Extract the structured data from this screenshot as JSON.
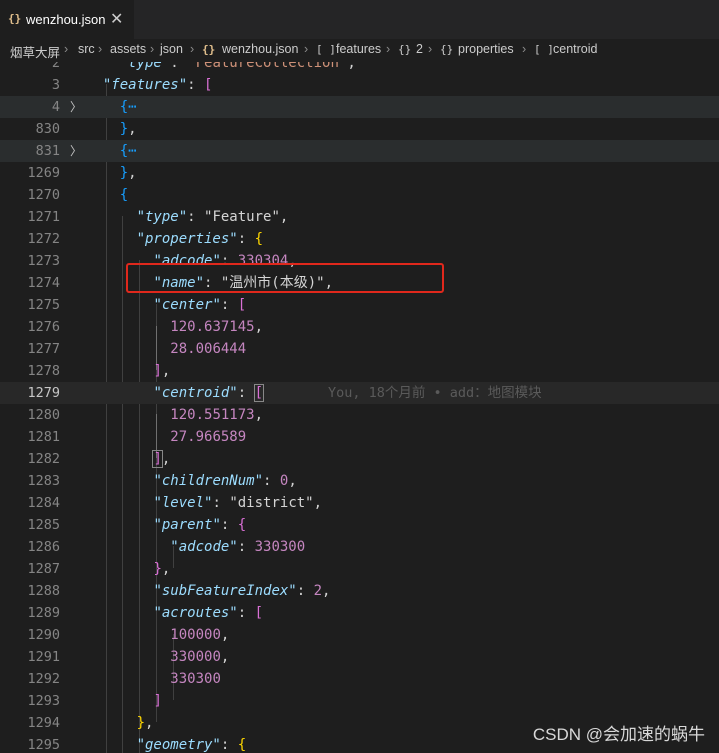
{
  "tab": {
    "icon": "{}",
    "title": "wenzhou.json",
    "close": "✕"
  },
  "breadcrumb": [
    "烟草大屏",
    "src",
    "assets",
    "json",
    "wenzhou.json",
    "features",
    "2",
    "properties",
    "centroid"
  ],
  "lines": {
    "l2": "2",
    "l3": "3",
    "l4": "4",
    "l830": "830",
    "l831": "831",
    "l1269": "1269",
    "l1270": "1270",
    "l1271": "1271",
    "l1272": "1272",
    "l1273": "1273",
    "l1274": "1274",
    "l1275": "1275",
    "l1276": "1276",
    "l1277": "1277",
    "l1278": "1278",
    "l1279": "1279",
    "l1280": "1280",
    "l1281": "1281",
    "l1282": "1282",
    "l1283": "1283",
    "l1284": "1284",
    "l1285": "1285",
    "l1286": "1286",
    "l1287": "1287",
    "l1288": "1288",
    "l1289": "1289",
    "l1290": "1290",
    "l1291": "1291",
    "l1292": "1292",
    "l1293": "1293",
    "l1294": "1294",
    "l1295": "1295"
  },
  "code": {
    "type_key": "\"type\"",
    "type_val": "\"FeatureCollection\"",
    "features_key": "\"features\"",
    "collapsed": "{⋯",
    "feature_type_key": "\"type\"",
    "feature_type_val": "\"Feature\"",
    "properties_key": "\"properties\"",
    "adcode_key": "\"adcode\"",
    "adcode_val": "330304",
    "name_key": "\"name\"",
    "name_val": "\"温州市(本级)\"",
    "center_key": "\"center\"",
    "center_x": "120.637145",
    "center_y": "28.006444",
    "centroid_key": "\"centroid\"",
    "centroid_x": "120.551173",
    "centroid_y": "27.966589",
    "childrenNum_key": "\"childrenNum\"",
    "childrenNum_val": "0",
    "level_key": "\"level\"",
    "level_val": "\"district\"",
    "parent_key": "\"parent\"",
    "parent_adcode_key": "\"adcode\"",
    "parent_adcode_val": "330300",
    "subFeatureIndex_key": "\"subFeatureIndex\"",
    "subFeatureIndex_val": "2",
    "acroutes_key": "\"acroutes\"",
    "acroutes": [
      "100000",
      "330000",
      "330300"
    ],
    "geometry_key": "\"geometry\""
  },
  "blame": "You, 18个月前 • add：地图模块",
  "watermark": "CSDN @会加速的蜗牛"
}
